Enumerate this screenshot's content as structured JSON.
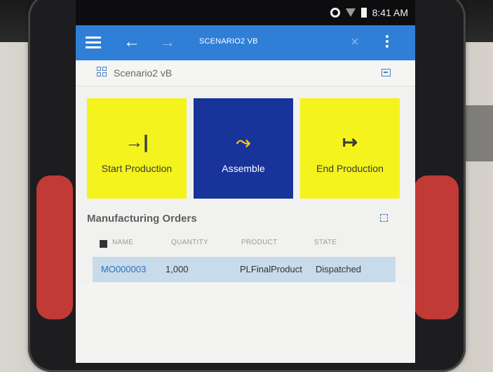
{
  "status_bar": {
    "time": "8:41 AM"
  },
  "app_bar": {
    "title": "SCENARIO2 VB"
  },
  "sub_header": {
    "title": "Scenario2 vB"
  },
  "tiles": [
    {
      "label": "Start Production",
      "icon": "→|",
      "color": "#f4f31d"
    },
    {
      "label": "Assemble",
      "icon": "⤳",
      "color": "#18339a"
    },
    {
      "label": "End Production",
      "icon": "↦",
      "color": "#f4f31d"
    }
  ],
  "orders": {
    "title": "Manufacturing Orders",
    "columns": [
      "NAME",
      "QUANTITY",
      "PRODUCT",
      "STATE"
    ],
    "rows": [
      {
        "name": "MO000003",
        "quantity": "1,000",
        "product": "PLFinalProduct",
        "state": "Dispatched"
      }
    ]
  },
  "colors": {
    "app_bar": "#2f7fd6",
    "accent_yellow": "#f4f31d",
    "accent_blue": "#18339a",
    "row_highlight": "#c7dbeb"
  }
}
